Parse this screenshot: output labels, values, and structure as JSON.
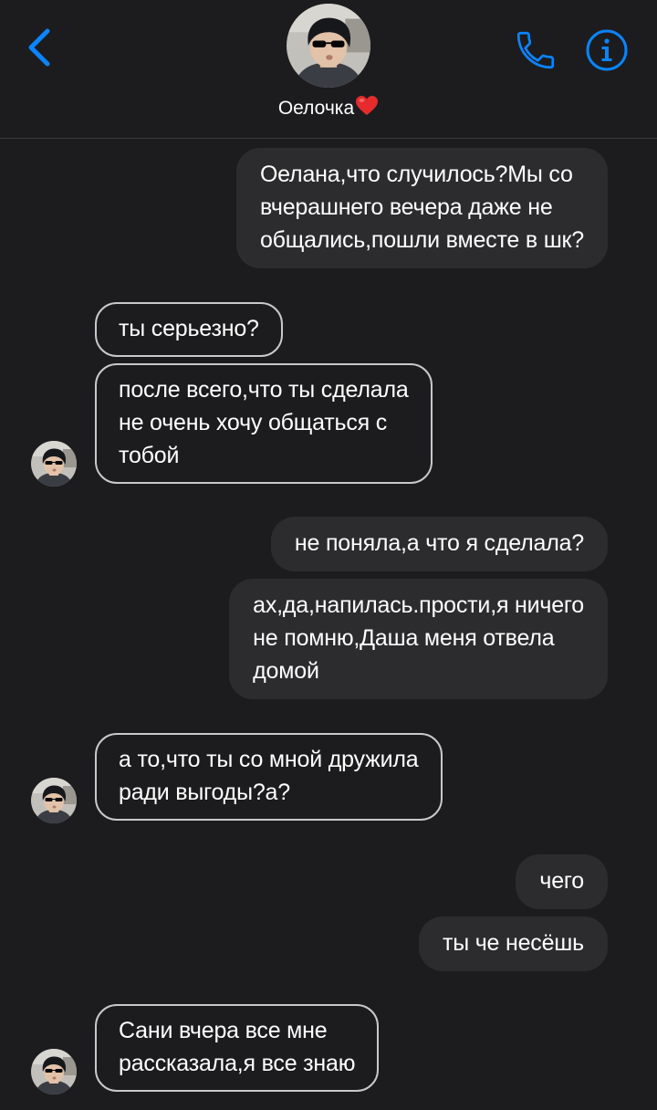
{
  "header": {
    "contact_name": "Оелочка",
    "back_icon": "chevron-left-icon",
    "call_icon": "phone-icon",
    "info_icon": "info-icon",
    "accent_color": "#0a84ff"
  },
  "messages": [
    {
      "direction": "outgoing",
      "text": "Оелана,что случилось?Мы со\nвчерашнего вечера даже не\nобщались,пошли вместе в шк?"
    },
    {
      "direction": "incoming",
      "text": "ты серьезно?"
    },
    {
      "direction": "incoming",
      "text": "после всего,что ты сделала\nне очень хочу общаться с\nтобой"
    },
    {
      "direction": "outgoing",
      "text": "не поняла,а что я сделала?"
    },
    {
      "direction": "outgoing",
      "text": "ах,да,напилась.прости,я ничего\nне помню,Даша меня отвела\nдомой"
    },
    {
      "direction": "incoming",
      "text": "а то,что ты со мной дружила\nради выгоды?а?"
    },
    {
      "direction": "outgoing",
      "text": "чего"
    },
    {
      "direction": "outgoing",
      "text": "ты че несёшь"
    },
    {
      "direction": "incoming",
      "text": "Сани вчера все мне\nрассказала,я все знаю"
    }
  ]
}
